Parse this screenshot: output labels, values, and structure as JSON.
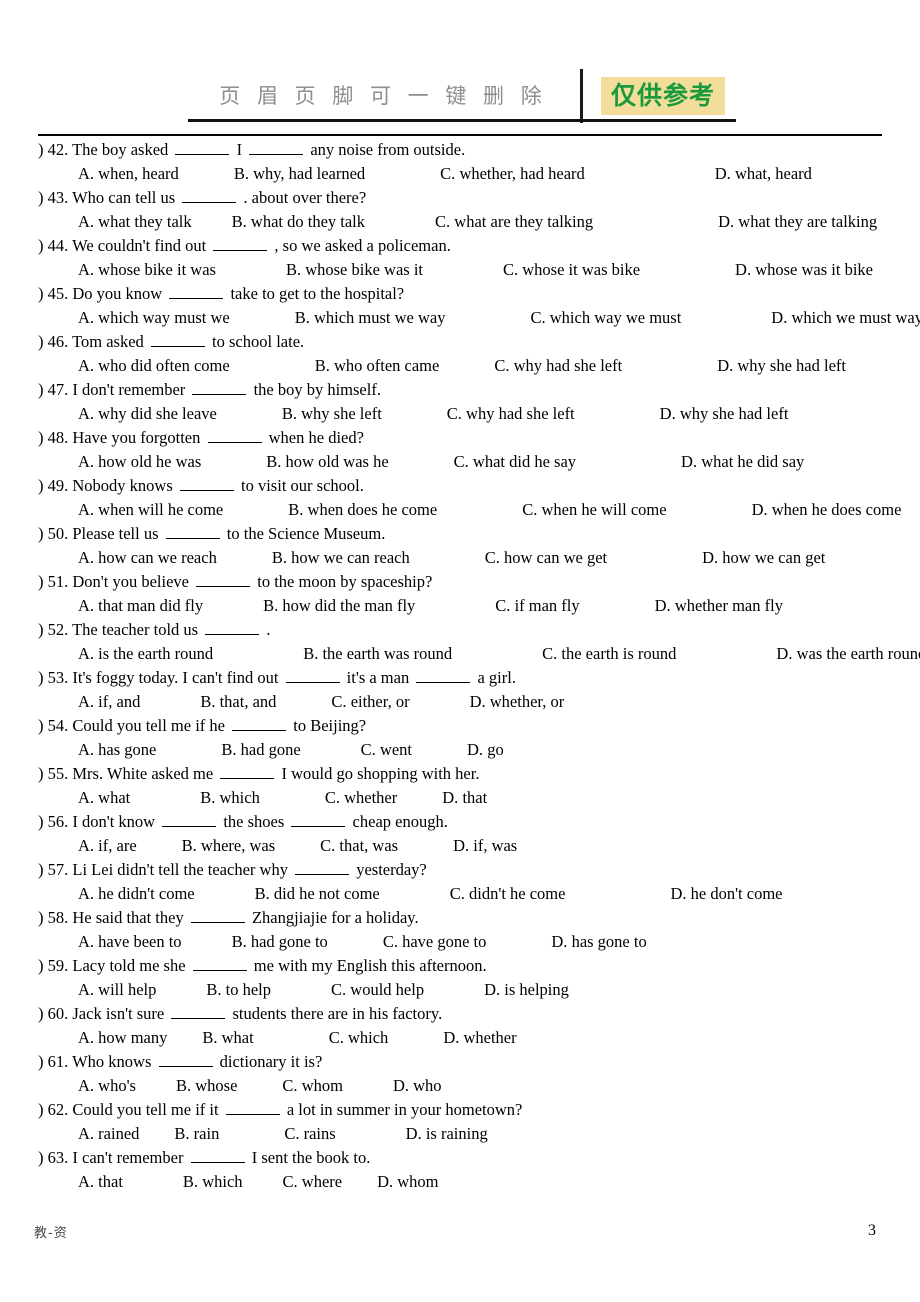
{
  "header": {
    "watermark_note": "页 眉 页 脚 可 一 键 删 除",
    "stamp_label": "仅供参考",
    "stamp_bg_color": "#f2dd9a",
    "stamp_text_color": "#1a9a3c",
    "note_color": "#8e8e8e"
  },
  "footer": {
    "source_label": "教-资",
    "page_number": "3"
  },
  "questions": [
    {
      "number": "42.",
      "stem_parts": [
        "The boy asked ",
        "BLANK",
        " I ",
        "BLANK",
        " any noise from outside."
      ],
      "options": [
        {
          "label": "A.",
          "text": "when, heard"
        },
        {
          "label": "B.",
          "text": "why, had learned"
        },
        {
          "label": "C.",
          "text": "whether, had heard"
        },
        {
          "label": "D.",
          "text": "what, heard"
        }
      ]
    },
    {
      "number": "43.",
      "stem_parts": [
        "Who can tell us ",
        "BLANK",
        " . about over there?"
      ],
      "options": [
        {
          "label": "A.",
          "text": "what they talk"
        },
        {
          "label": "B.",
          "text": "what do they talk"
        },
        {
          "label": "C.",
          "text": "what are they talking"
        },
        {
          "label": "D.",
          "text": "what they are talking"
        }
      ]
    },
    {
      "number": "44.",
      "stem_parts": [
        "We couldn't find out ",
        "BLANK",
        " , so we asked a policeman."
      ],
      "options": [
        {
          "label": "A.",
          "text": "whose bike it was"
        },
        {
          "label": "B.",
          "text": "whose bike was it"
        },
        {
          "label": "C.",
          "text": "whose it was bike"
        },
        {
          "label": "D.",
          "text": "whose was it bike"
        }
      ]
    },
    {
      "number": "45.",
      "stem_parts": [
        "Do you know ",
        "BLANK",
        " take to get to the hospital?"
      ],
      "options": [
        {
          "label": "A.",
          "text": "which way must we"
        },
        {
          "label": "B.",
          "text": "which must we way"
        },
        {
          "label": "C.",
          "text": "which way we must"
        },
        {
          "label": "D.",
          "text": "which we must way"
        }
      ]
    },
    {
      "number": "46.",
      "stem_parts": [
        "Tom asked ",
        "BLANK",
        " to school late."
      ],
      "options": [
        {
          "label": "A.",
          "text": "who did often come"
        },
        {
          "label": "B.",
          "text": "who often came"
        },
        {
          "label": "C.",
          "text": "why had she left"
        },
        {
          "label": "D.",
          "text": "why she had left"
        }
      ]
    },
    {
      "number": "47.",
      "stem_parts": [
        "I don't remember ",
        "BLANK",
        " the boy by himself."
      ],
      "options": [
        {
          "label": "A.",
          "text": "why did she leave"
        },
        {
          "label": "B.",
          "text": "why she left"
        },
        {
          "label": "C.",
          "text": "why had she left"
        },
        {
          "label": "D.",
          "text": "why she had left"
        }
      ]
    },
    {
      "number": "48.",
      "stem_parts": [
        "Have you forgotten ",
        "BLANK",
        " when he died?"
      ],
      "options": [
        {
          "label": "A.",
          "text": "how old he was"
        },
        {
          "label": "B.",
          "text": "how old was he"
        },
        {
          "label": "C.",
          "text": "what did he say"
        },
        {
          "label": "D.",
          "text": "what he did say"
        }
      ]
    },
    {
      "number": "49.",
      "stem_parts": [
        "Nobody knows ",
        "BLANK",
        " to visit our school."
      ],
      "options": [
        {
          "label": "A.",
          "text": "when will he come"
        },
        {
          "label": "B.",
          "text": "when does he come"
        },
        {
          "label": "C.",
          "text": "when he will come"
        },
        {
          "label": "D.",
          "text": "when he does come"
        }
      ]
    },
    {
      "number": "50.",
      "stem_parts": [
        "Please tell us ",
        "BLANK",
        " to the Science Museum."
      ],
      "options": [
        {
          "label": "A.",
          "text": "how can we reach"
        },
        {
          "label": "B.",
          "text": "how we can reach"
        },
        {
          "label": "C.",
          "text": "how can we get"
        },
        {
          "label": "D.",
          "text": "how we can get"
        }
      ]
    },
    {
      "number": "51.",
      "stem_parts": [
        "Don't you believe ",
        "BLANK",
        " to the moon by spaceship?"
      ],
      "options": [
        {
          "label": "A.",
          "text": "that man did fly"
        },
        {
          "label": "B.",
          "text": "how did the man fly"
        },
        {
          "label": "C.",
          "text": "if man fly"
        },
        {
          "label": "D.",
          "text": "whether man fly"
        }
      ]
    },
    {
      "number": "52.",
      "stem_parts": [
        "The teacher told us ",
        "BLANK",
        " ."
      ],
      "options": [
        {
          "label": "A.",
          "text": "is the earth round"
        },
        {
          "label": "B.",
          "text": "the earth was round"
        },
        {
          "label": "C.",
          "text": "the earth is round"
        },
        {
          "label": "D.",
          "text": "was the earth round"
        }
      ]
    },
    {
      "number": "53.",
      "stem_parts": [
        "It's foggy today. I can't find out ",
        "BLANK",
        " it's a man ",
        "BLANK",
        " a girl."
      ],
      "options": [
        {
          "label": "A.",
          "text": "if, and"
        },
        {
          "label": "B.",
          "text": "that, and"
        },
        {
          "label": "C.",
          "text": "either, or"
        },
        {
          "label": "D.",
          "text": "whether, or"
        }
      ]
    },
    {
      "number": "54.",
      "stem_parts": [
        "Could you tell me if he ",
        "BLANK",
        " to Beijing?"
      ],
      "options": [
        {
          "label": "A.",
          "text": "has gone"
        },
        {
          "label": "B.",
          "text": "had gone"
        },
        {
          "label": "C.",
          "text": "went"
        },
        {
          "label": "D.",
          "text": "go"
        }
      ]
    },
    {
      "number": "55.",
      "stem_parts": [
        "Mrs. White asked me ",
        "BLANK",
        " I would go shopping with her."
      ],
      "options": [
        {
          "label": "A.",
          "text": "what"
        },
        {
          "label": "B.",
          "text": "which"
        },
        {
          "label": "C.",
          "text": "whether"
        },
        {
          "label": "D.",
          "text": "that"
        }
      ]
    },
    {
      "number": "56.",
      "stem_parts": [
        "I don't know ",
        "BLANK",
        " the shoes ",
        "BLANK",
        " cheap enough."
      ],
      "options": [
        {
          "label": "A.",
          "text": "if, are"
        },
        {
          "label": "B.",
          "text": "where, was"
        },
        {
          "label": "C.",
          "text": "that, was"
        },
        {
          "label": "D.",
          "text": "if, was"
        }
      ]
    },
    {
      "number": "57.",
      "stem_parts": [
        "Li Lei didn't tell the teacher why ",
        "BLANK",
        " yesterday?"
      ],
      "options": [
        {
          "label": "A.",
          "text": "he didn't come"
        },
        {
          "label": "B.",
          "text": "did he not come"
        },
        {
          "label": "C.",
          "text": "didn't he come"
        },
        {
          "label": "D.",
          "text": "he don't come"
        }
      ]
    },
    {
      "number": "58.",
      "stem_parts": [
        "He said that they ",
        "BLANK",
        " Zhangjiajie for a holiday."
      ],
      "options": [
        {
          "label": "A.",
          "text": "have been to"
        },
        {
          "label": "B.",
          "text": "had gone to"
        },
        {
          "label": "C.",
          "text": "have gone to"
        },
        {
          "label": "D.",
          "text": "has gone to"
        }
      ]
    },
    {
      "number": "59.",
      "stem_parts": [
        "Lacy told me she ",
        "BLANK",
        " me with my English this afternoon."
      ],
      "options": [
        {
          "label": "A.",
          "text": "will help"
        },
        {
          "label": "B.",
          "text": "to help"
        },
        {
          "label": "C.",
          "text": "would help"
        },
        {
          "label": "D.",
          "text": "is helping"
        }
      ]
    },
    {
      "number": "60.",
      "stem_parts": [
        "Jack isn't sure ",
        "BLANK",
        " students there are in his factory."
      ],
      "options": [
        {
          "label": "A.",
          "text": "how many"
        },
        {
          "label": "B.",
          "text": "what"
        },
        {
          "label": "C.",
          "text": "which"
        },
        {
          "label": "D.",
          "text": "whether"
        }
      ]
    },
    {
      "number": "61.",
      "stem_parts": [
        "Who knows ",
        "BLANK",
        " dictionary it is?"
      ],
      "options": [
        {
          "label": "A.",
          "text": "who's"
        },
        {
          "label": "B.",
          "text": "whose"
        },
        {
          "label": "C.",
          "text": "whom"
        },
        {
          "label": "D.",
          "text": "who"
        }
      ]
    },
    {
      "number": "62.",
      "stem_parts": [
        "Could you tell me if it ",
        "BLANK",
        " a lot in summer in your hometown?"
      ],
      "options": [
        {
          "label": "A.",
          "text": "rained"
        },
        {
          "label": "B.",
          "text": "rain"
        },
        {
          "label": "C.",
          "text": "rains"
        },
        {
          "label": "D.",
          "text": "is raining"
        }
      ]
    },
    {
      "number": "63.",
      "stem_parts": [
        "I can't remember ",
        "BLANK",
        " I sent the book to."
      ],
      "options": [
        {
          "label": "A.",
          "text": "that"
        },
        {
          "label": "B.",
          "text": "which"
        },
        {
          "label": "C.",
          "text": "where"
        },
        {
          "label": "D.",
          "text": "whom"
        }
      ]
    }
  ],
  "option_column_offsets": [
    [
      0,
      150,
      320,
      545
    ],
    [
      0,
      135,
      300,
      520
    ],
    [
      0,
      165,
      340,
      530
    ],
    [
      0,
      160,
      340,
      525
    ],
    [
      0,
      180,
      330,
      520
    ],
    [
      0,
      160,
      320,
      500
    ],
    [
      0,
      160,
      320,
      520
    ],
    [
      0,
      160,
      340,
      520
    ],
    [
      0,
      150,
      320,
      510
    ],
    [
      0,
      155,
      330,
      500
    ],
    [
      0,
      185,
      370,
      565
    ],
    [
      0,
      155,
      305,
      460
    ],
    [
      0,
      160,
      315,
      465
    ],
    [
      0,
      165,
      325,
      465
    ],
    [
      0,
      140,
      280,
      430
    ],
    [
      0,
      155,
      320,
      520
    ],
    [
      0,
      145,
      295,
      455
    ],
    [
      0,
      145,
      300,
      455
    ],
    [
      0,
      130,
      300,
      450
    ],
    [
      0,
      135,
      275,
      420
    ],
    [
      0,
      130,
      290,
      455
    ],
    [
      0,
      155,
      290,
      420
    ]
  ]
}
